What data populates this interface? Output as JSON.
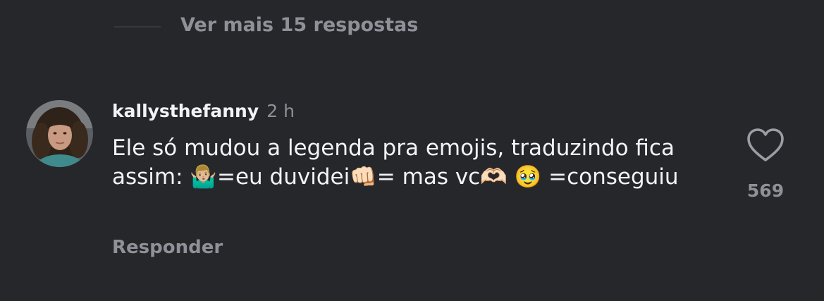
{
  "replies_toggle": {
    "label": "Ver mais 15 respostas"
  },
  "comment": {
    "username": "kallysthefanny",
    "timestamp": "2 h",
    "text": "Ele só mudou a legenda pra emojis, traduzindo fica assim: 🤷🏼‍♂️=eu duvidei👊🏻= mas vc🫶🏻 🥹 =conseguiu",
    "like_count": "569",
    "reply_label": "Responder",
    "like_icon": "heart-outline-icon"
  },
  "colors": {
    "background": "#25272b",
    "primary_text": "#f2f3f5",
    "secondary_text": "#8e9197"
  }
}
